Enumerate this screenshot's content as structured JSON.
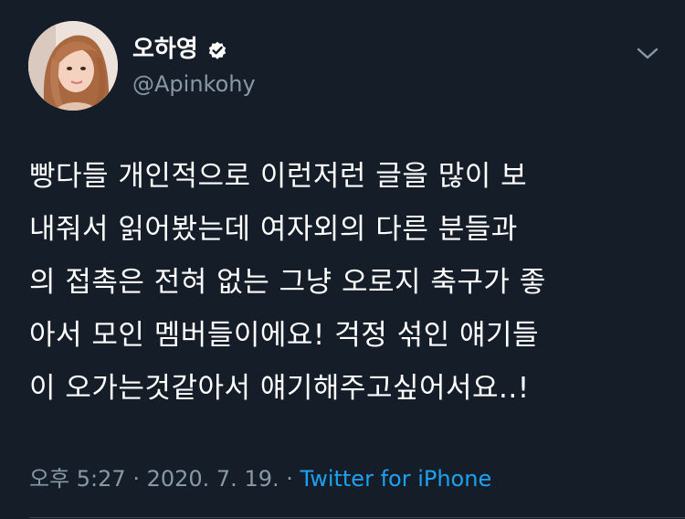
{
  "tweet": {
    "display_name": "오하영",
    "handle": "@Apinkohy",
    "verified_icon": "verified-badge-icon",
    "menu_icon": "chevron-down-icon",
    "text_lines": [
      "빵다들 개인적으로 이런저런 글을 많이 보",
      "내줘서 읽어봤는데 여자외의 다른 분들과",
      "의 접촉은 전혀 없는 그냥 오로지 축구가 좋",
      "아서 모인 멤버들이에요! 걱정 섞인 얘기들",
      "이 오가는것같아서 얘기해주고싶어서요..!"
    ],
    "time": "오후 5:27",
    "separator": " · ",
    "date": "2020. 7. 19.",
    "source": "Twitter for iPhone"
  },
  "colors": {
    "background": "#151e28",
    "text_primary": "#ffffff",
    "text_secondary": "#8899a6",
    "accent": "#1da1f2"
  }
}
